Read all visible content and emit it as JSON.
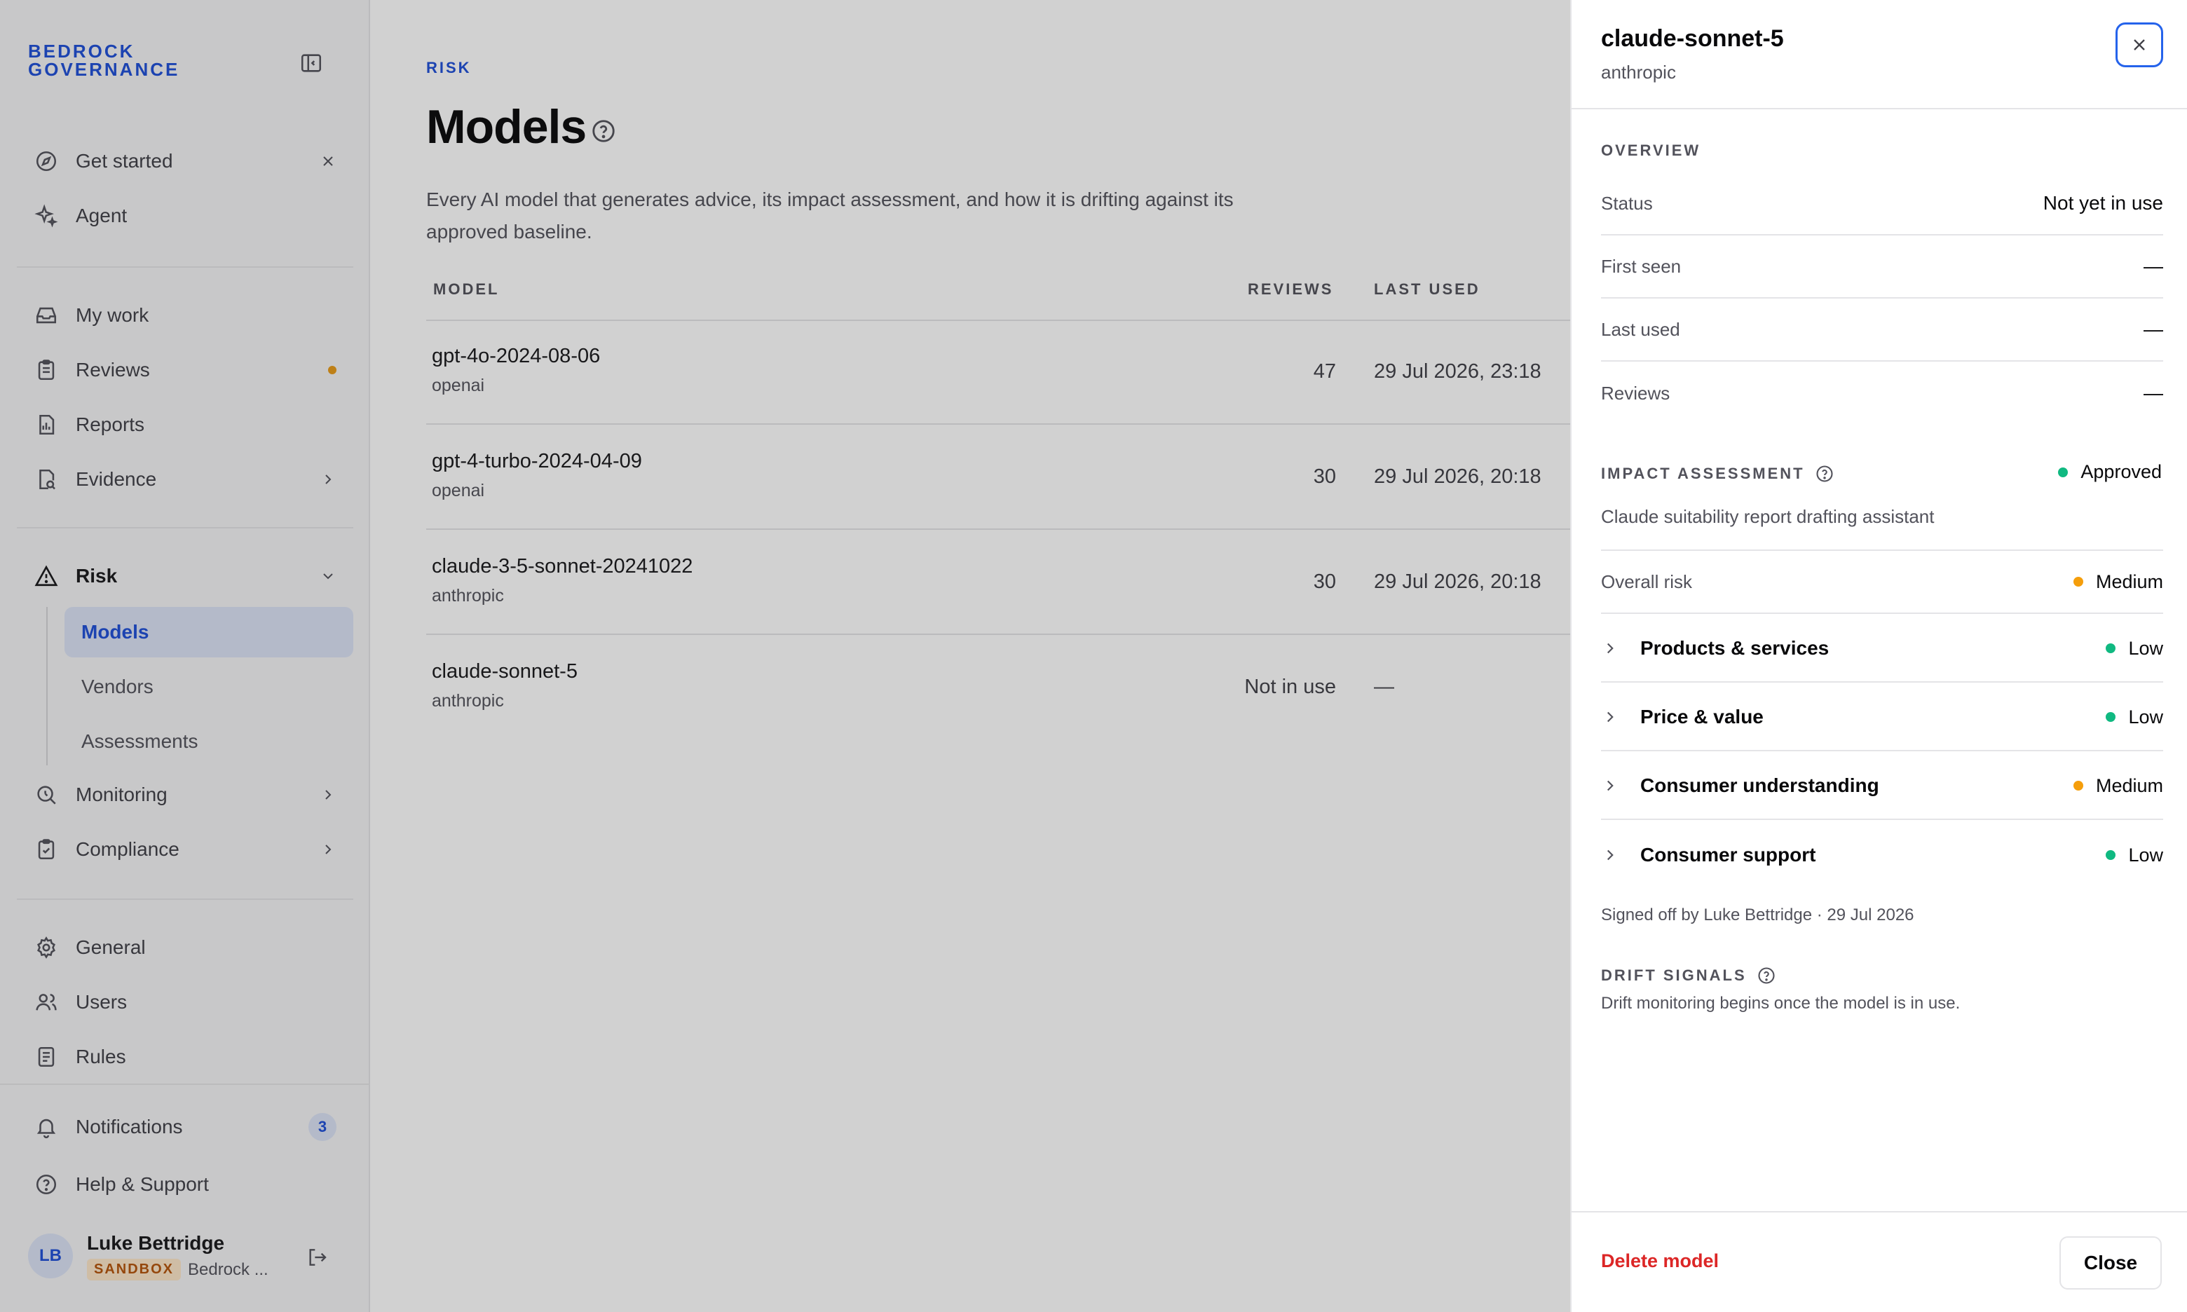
{
  "app": {
    "brand_line1": "BEDROCK",
    "brand_line2": "GOVERNANCE"
  },
  "sidebar": {
    "top": [
      {
        "label": "Get started",
        "icon": "compass-icon"
      },
      {
        "label": "Agent",
        "icon": "sparkles-icon"
      }
    ],
    "work": [
      {
        "label": "My work",
        "icon": "inbox-icon"
      },
      {
        "label": "Reviews",
        "icon": "clipboard-icon"
      },
      {
        "label": "Reports",
        "icon": "report-icon"
      },
      {
        "label": "Evidence",
        "icon": "file-search-icon"
      }
    ],
    "risk": {
      "label": "Risk",
      "icon": "warning-icon",
      "sub": [
        "Models",
        "Vendors",
        "Assessments"
      ]
    },
    "more": [
      {
        "label": "Monitoring",
        "icon": "search-icon"
      },
      {
        "label": "Compliance",
        "icon": "clipboard-check-icon"
      }
    ],
    "admin": [
      {
        "label": "General",
        "icon": "gear-icon"
      },
      {
        "label": "Users",
        "icon": "users-icon"
      },
      {
        "label": "Rules",
        "icon": "document-icon"
      }
    ],
    "footer": {
      "notifications": {
        "label": "Notifications",
        "count": "3"
      },
      "help": "Help & Support",
      "user": {
        "initials": "LB",
        "name": "Luke Bettridge",
        "badge": "SANDBOX",
        "org": "Bedrock ..."
      }
    }
  },
  "main": {
    "breadcrumb": "RISK",
    "title": "Models",
    "description": "Every AI model that generates advice, its impact assessment, and how it is drifting against its approved baseline.",
    "columns": {
      "model": "MODEL",
      "reviews": "REVIEWS",
      "last_used": "LAST USED"
    },
    "rows": [
      {
        "name": "gpt-4o-2024-08-06",
        "vendor": "openai",
        "reviews": "47",
        "last_used": "29 Jul 2026, 23:18"
      },
      {
        "name": "gpt-4-turbo-2024-04-09",
        "vendor": "openai",
        "reviews": "30",
        "last_used": "29 Jul 2026, 20:18"
      },
      {
        "name": "claude-3-5-sonnet-20241022",
        "vendor": "anthropic",
        "reviews": "30",
        "last_used": "29 Jul 2026, 20:18"
      },
      {
        "name": "claude-sonnet-5",
        "vendor": "anthropic",
        "reviews": "Not in use",
        "last_used": "—"
      }
    ]
  },
  "drawer": {
    "title": "claude-sonnet-5",
    "subtitle": "anthropic",
    "overview_label": "OVERVIEW",
    "overview": [
      {
        "key": "Status",
        "value": "Not yet in use"
      },
      {
        "key": "First seen",
        "value": "—"
      },
      {
        "key": "Last used",
        "value": "—"
      },
      {
        "key": "Reviews",
        "value": "—"
      }
    ],
    "impact": {
      "label": "IMPACT ASSESSMENT",
      "status": "Approved",
      "description": "Claude suitability report drafting assistant",
      "overall_key": "Overall risk",
      "overall_value": "Medium",
      "items": [
        {
          "label": "Products & services",
          "value": "Low",
          "level": "low"
        },
        {
          "label": "Price & value",
          "value": "Low",
          "level": "low"
        },
        {
          "label": "Consumer understanding",
          "value": "Medium",
          "level": "medium"
        },
        {
          "label": "Consumer support",
          "value": "Low",
          "level": "low"
        }
      ],
      "signed": "Signed off by Luke Bettridge · 29 Jul 2026"
    },
    "drift": {
      "label": "DRIFT SIGNALS",
      "description": "Drift monitoring begins once the model is in use."
    },
    "delete_label": "Delete model",
    "close_label": "Close"
  },
  "colors": {
    "accent": "#1d4ed8",
    "low": "#10b981",
    "medium": "#f59e0b",
    "danger": "#dc2626",
    "notice": "#e89a17"
  }
}
